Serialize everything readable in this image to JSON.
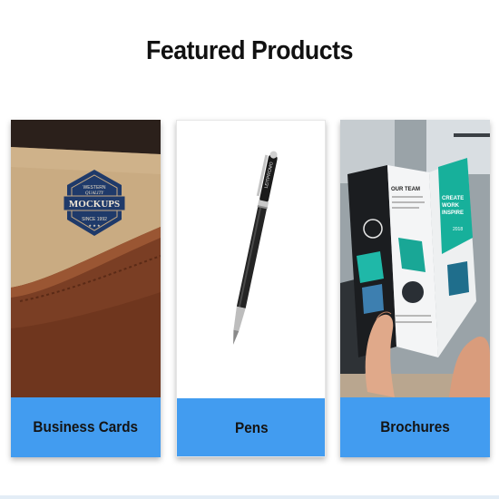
{
  "section": {
    "title": "Featured Products"
  },
  "products": [
    {
      "label": "Business Cards",
      "image_text": {
        "top": "WESTERN",
        "mid": "QUALITY",
        "brand": "MOCKUPS",
        "since": "SINCE 1992"
      }
    },
    {
      "label": "Pens",
      "image_text": {
        "engraving": "LEITPROMO"
      }
    },
    {
      "label": "Brochures",
      "image_text": {
        "heading": "OUR TEAM",
        "tagline1": "CREATE",
        "tagline2": "WORK",
        "tagline3": "INSPIRE",
        "year": "2018"
      }
    }
  ],
  "colors": {
    "label_bg": "#429cf0",
    "title": "#111111"
  }
}
